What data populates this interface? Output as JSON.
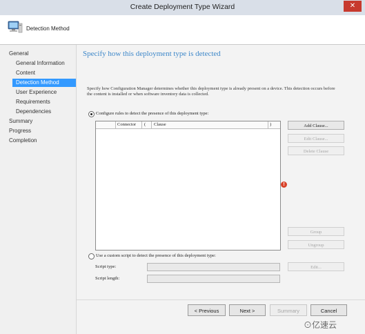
{
  "window": {
    "title": "Create Deployment Type Wizard",
    "close_glyph": "✕"
  },
  "header": {
    "label": "Detection Method",
    "icon": "computer-icon"
  },
  "nav": {
    "items": [
      {
        "label": "General",
        "indent": false,
        "selected": false
      },
      {
        "label": "General Information",
        "indent": true,
        "selected": false
      },
      {
        "label": "Content",
        "indent": true,
        "selected": false
      },
      {
        "label": "Detection Method",
        "indent": true,
        "selected": true
      },
      {
        "label": "User Experience",
        "indent": true,
        "selected": false
      },
      {
        "label": "Requirements",
        "indent": true,
        "selected": false
      },
      {
        "label": "Dependencies",
        "indent": true,
        "selected": false
      },
      {
        "label": "Summary",
        "indent": false,
        "selected": false
      },
      {
        "label": "Progress",
        "indent": false,
        "selected": false
      },
      {
        "label": "Completion",
        "indent": false,
        "selected": false
      }
    ]
  },
  "page": {
    "title": "Specify how this deployment type is detected",
    "description": "Specify how Configuration Manager determines whether this deployment type is already present on a device. This detection occurs before the content is installed or when software inventory data is collected.",
    "option_rules": "Configure rules to detect the presence of this deployment type:",
    "option_script": "Use a custom script to detect the presence of this deployment type:",
    "columns": {
      "connector": "Connector",
      "open_paren": "(",
      "clause": "Clause",
      "close_paren": ")"
    },
    "buttons": {
      "add_clause": "Add Clause...",
      "edit_clause": "Edit Clause...",
      "delete_clause": "Delete Clause",
      "group": "Group",
      "ungroup": "Ungroup",
      "edit": "Edit..."
    },
    "script_type_label": "Script type:",
    "script_length_label": "Script length:",
    "warning_glyph": "!"
  },
  "footer": {
    "previous": "< Previous",
    "next": "Next >",
    "summary": "Summary",
    "cancel": "Cancel"
  },
  "watermark": "⊙亿速云",
  "colors": {
    "accent": "#3399ff",
    "title_blue": "#3d87c9",
    "warning": "#d9442b"
  }
}
